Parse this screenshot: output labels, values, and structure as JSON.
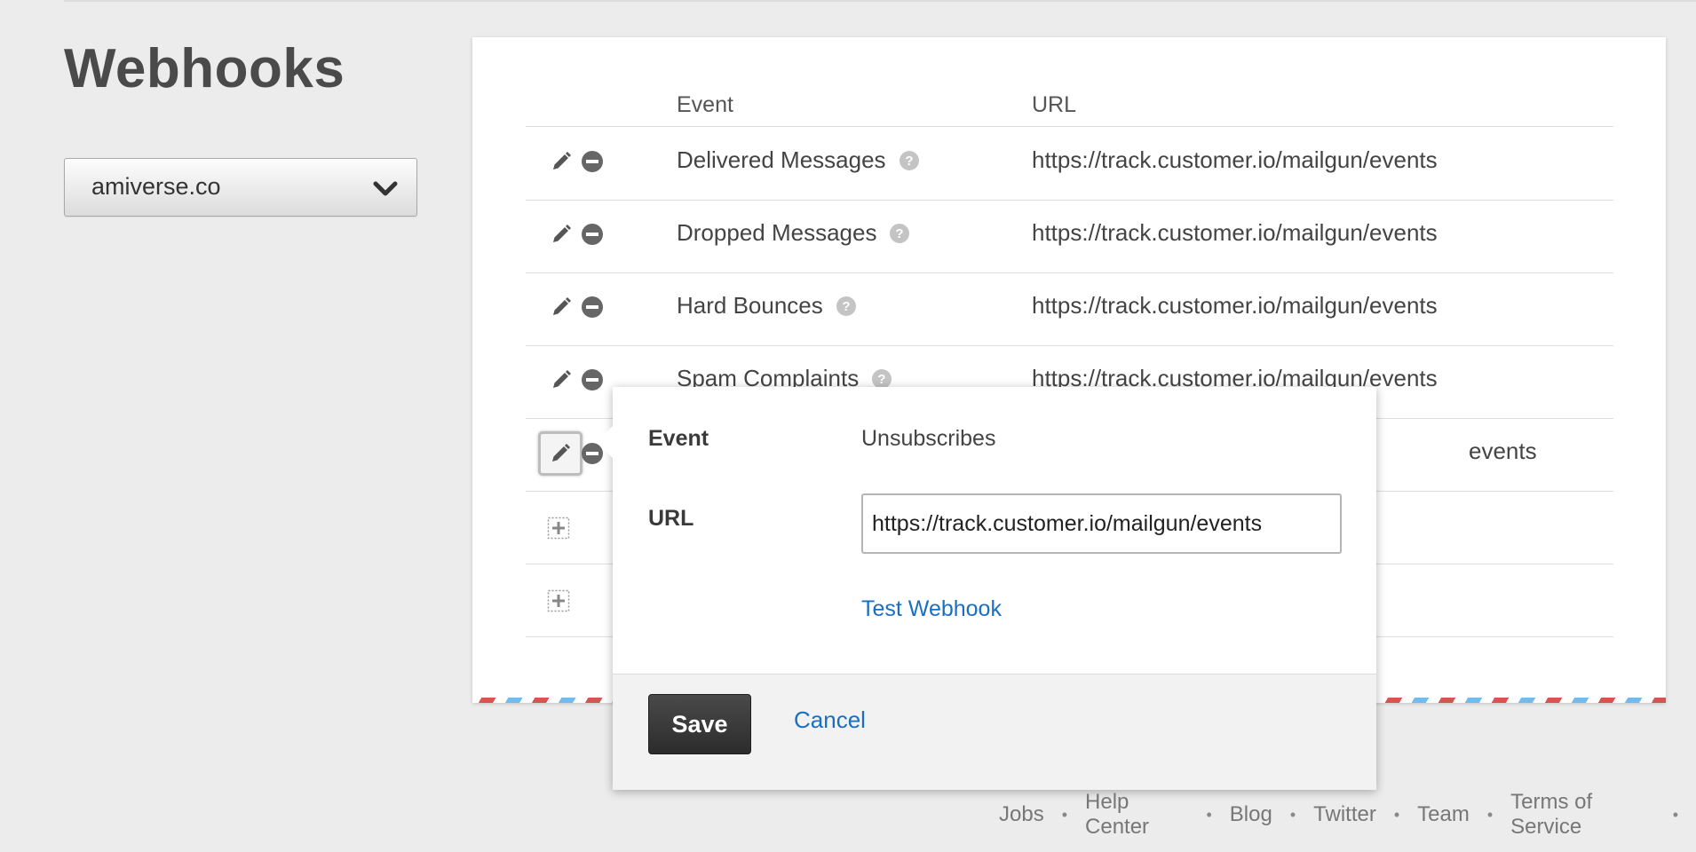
{
  "page": {
    "title": "Webhooks"
  },
  "domain_select": {
    "value": "amiverse.co"
  },
  "table": {
    "headers": {
      "event": "Event",
      "url": "URL"
    },
    "rows": [
      {
        "event": "Delivered Messages",
        "url": "https://track.customer.io/mailgun/events"
      },
      {
        "event": "Dropped Messages",
        "url": "https://track.customer.io/mailgun/events"
      },
      {
        "event": "Hard Bounces",
        "url": "https://track.customer.io/mailgun/events"
      },
      {
        "event": "Spam Complaints",
        "url": "https://track.customer.io/mailgun/events"
      },
      {
        "event": "Unsubscribes",
        "url": "https://track.customer.io/mailgun/events"
      }
    ],
    "partial_url_visible": "events"
  },
  "popover": {
    "event_label": "Event",
    "event_value": "Unsubscribes",
    "url_label": "URL",
    "url_value": "https://track.customer.io/mailgun/events",
    "test_link": "Test Webhook",
    "save_label": "Save",
    "cancel_label": "Cancel"
  },
  "footer": {
    "links": [
      "Jobs",
      "Help Center",
      "Blog",
      "Twitter",
      "Team",
      "Terms of Service"
    ],
    "separator": "•"
  },
  "colors": {
    "link": "#1a6fc1",
    "save_button": "#333333",
    "airmail_red": "#d9534f",
    "airmail_blue": "#6fbdf0"
  },
  "icons": [
    "pencil-icon",
    "minus-circle-icon",
    "question-circle-icon",
    "plus-square-icon",
    "chevron-down-icon"
  ]
}
